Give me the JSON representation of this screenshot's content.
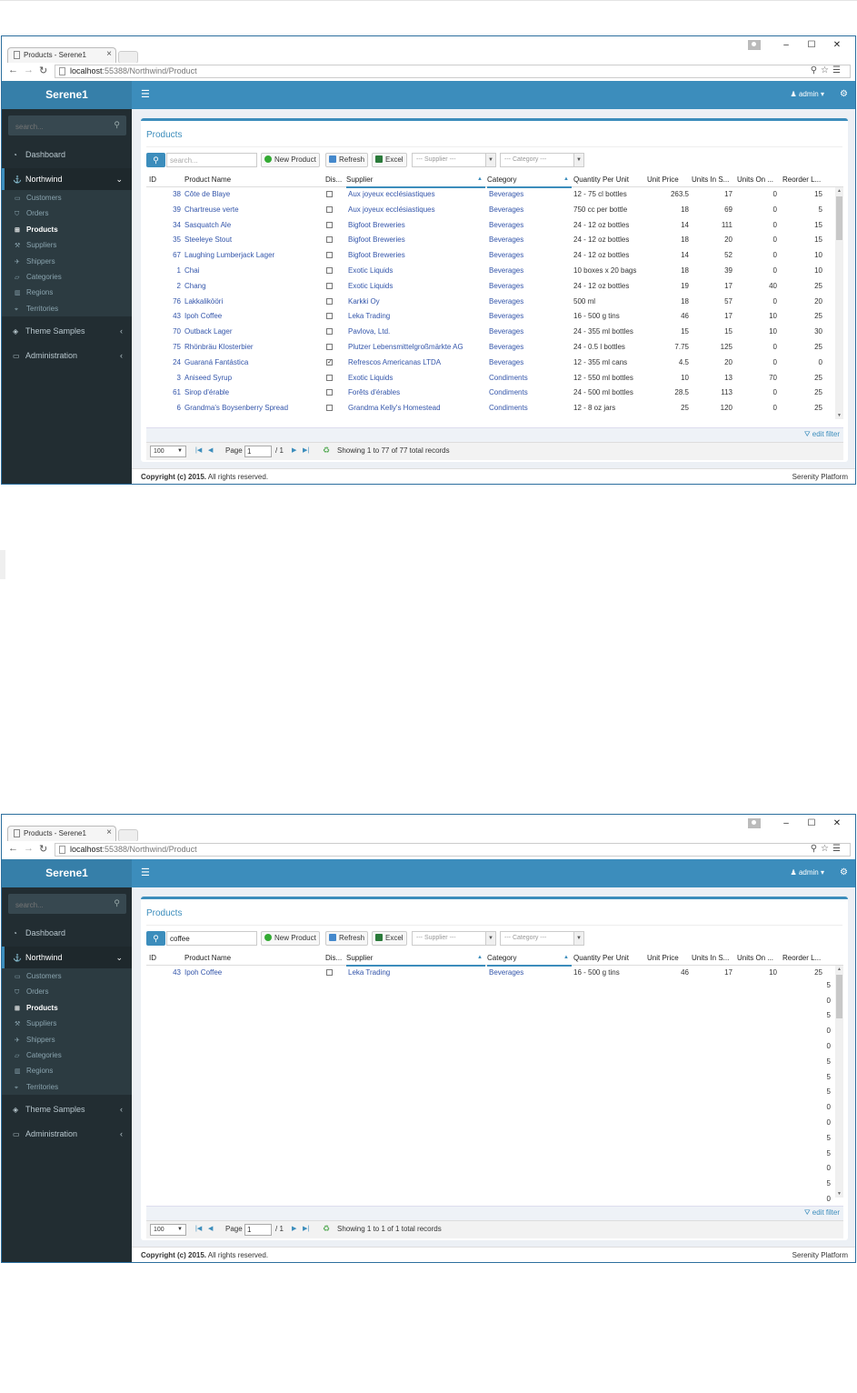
{
  "browser": {
    "tab_title": "Products - Serene1",
    "url_host": "localhost",
    "url_rest": ":55388/Northwind/Product"
  },
  "app": {
    "logo": "Serene1",
    "sidebar_search_placeholder": "search...",
    "user": "admin",
    "menu": {
      "dashboard": "Dashboard",
      "northwind": "Northwind",
      "theme_samples": "Theme Samples",
      "administration": "Administration",
      "sub": [
        "Customers",
        "Orders",
        "Products",
        "Suppliers",
        "Shippers",
        "Categories",
        "Regions",
        "Territories"
      ]
    },
    "page_title": "Products",
    "toolbar": {
      "search_placeholder": "search...",
      "new_product": "New Product",
      "refresh": "Refresh",
      "excel": "Excel",
      "supplier_dd": "--- Supplier ---",
      "category_dd": "--- Category ---"
    },
    "columns": [
      "ID",
      "Product Name",
      "Dis...",
      "Supplier",
      "Category",
      "Quantity Per Unit",
      "Unit Price",
      "Units In S...",
      "Units On ...",
      "Reorder L..."
    ],
    "edit_filter": "edit filter",
    "pager": {
      "page_size": "100",
      "page_label": "Page",
      "page_value": "1",
      "page_of": "/ 1"
    },
    "footer": {
      "copyright_bold": "Copyright (c) 2015.",
      "copyright_rest": "All rights reserved.",
      "platform": "Serenity Platform"
    }
  },
  "screens": [
    {
      "search_value": "",
      "status": "Showing 1 to 77 of 77 total records",
      "rows": [
        {
          "id": "38",
          "name": "Côte de Blaye",
          "disc": false,
          "supplier": "Aux joyeux ecclésiastiques",
          "category": "Beverages",
          "qty": "12 - 75 cl bottles",
          "price": "263.5",
          "stock": "17",
          "order": "0",
          "reorder": "15"
        },
        {
          "id": "39",
          "name": "Chartreuse verte",
          "disc": false,
          "supplier": "Aux joyeux ecclésiastiques",
          "category": "Beverages",
          "qty": "750 cc per bottle",
          "price": "18",
          "stock": "69",
          "order": "0",
          "reorder": "5"
        },
        {
          "id": "34",
          "name": "Sasquatch Ale",
          "disc": false,
          "supplier": "Bigfoot Breweries",
          "category": "Beverages",
          "qty": "24 - 12 oz bottles",
          "price": "14",
          "stock": "111",
          "order": "0",
          "reorder": "15"
        },
        {
          "id": "35",
          "name": "Steeleye Stout",
          "disc": false,
          "supplier": "Bigfoot Breweries",
          "category": "Beverages",
          "qty": "24 - 12 oz bottles",
          "price": "18",
          "stock": "20",
          "order": "0",
          "reorder": "15"
        },
        {
          "id": "67",
          "name": "Laughing Lumberjack Lager",
          "disc": false,
          "supplier": "Bigfoot Breweries",
          "category": "Beverages",
          "qty": "24 - 12 oz bottles",
          "price": "14",
          "stock": "52",
          "order": "0",
          "reorder": "10"
        },
        {
          "id": "1",
          "name": "Chai",
          "disc": false,
          "supplier": "Exotic Liquids",
          "category": "Beverages",
          "qty": "10 boxes x 20 bags",
          "price": "18",
          "stock": "39",
          "order": "0",
          "reorder": "10"
        },
        {
          "id": "2",
          "name": "Chang",
          "disc": false,
          "supplier": "Exotic Liquids",
          "category": "Beverages",
          "qty": "24 - 12 oz bottles",
          "price": "19",
          "stock": "17",
          "order": "40",
          "reorder": "25"
        },
        {
          "id": "76",
          "name": "Lakkalikööri",
          "disc": false,
          "supplier": "Karkki Oy",
          "category": "Beverages",
          "qty": "500 ml",
          "price": "18",
          "stock": "57",
          "order": "0",
          "reorder": "20"
        },
        {
          "id": "43",
          "name": "Ipoh Coffee",
          "disc": false,
          "supplier": "Leka Trading",
          "category": "Beverages",
          "qty": "16 - 500 g tins",
          "price": "46",
          "stock": "17",
          "order": "10",
          "reorder": "25"
        },
        {
          "id": "70",
          "name": "Outback Lager",
          "disc": false,
          "supplier": "Pavlova, Ltd.",
          "category": "Beverages",
          "qty": "24 - 355 ml bottles",
          "price": "15",
          "stock": "15",
          "order": "10",
          "reorder": "30"
        },
        {
          "id": "75",
          "name": "Rhönbräu Klosterbier",
          "disc": false,
          "supplier": "Plutzer Lebensmittelgroßmärkte AG",
          "category": "Beverages",
          "qty": "24 - 0.5 l bottles",
          "price": "7.75",
          "stock": "125",
          "order": "0",
          "reorder": "25"
        },
        {
          "id": "24",
          "name": "Guaraná Fantástica",
          "disc": true,
          "supplier": "Refrescos Americanas LTDA",
          "category": "Beverages",
          "qty": "12 - 355 ml cans",
          "price": "4.5",
          "stock": "20",
          "order": "0",
          "reorder": "0"
        },
        {
          "id": "3",
          "name": "Aniseed Syrup",
          "disc": false,
          "supplier": "Exotic Liquids",
          "category": "Condiments",
          "qty": "12 - 550 ml bottles",
          "price": "10",
          "stock": "13",
          "order": "70",
          "reorder": "25"
        },
        {
          "id": "61",
          "name": "Sirop d'érable",
          "disc": false,
          "supplier": "Forêts d'érables",
          "category": "Condiments",
          "qty": "24 - 500 ml bottles",
          "price": "28.5",
          "stock": "113",
          "order": "0",
          "reorder": "25"
        },
        {
          "id": "6",
          "name": "Grandma's Boysenberry Spread",
          "disc": false,
          "supplier": "Grandma Kelly's Homestead",
          "category": "Condiments",
          "qty": "12 - 8 oz jars",
          "price": "25",
          "stock": "120",
          "order": "0",
          "reorder": "25"
        }
      ]
    },
    {
      "search_value": "coffee",
      "status": "Showing 1 to 1 of 1 total records",
      "rows": [
        {
          "id": "43",
          "name": "Ipoh Coffee",
          "disc": false,
          "supplier": "Leka Trading",
          "category": "Beverages",
          "qty": "16 - 500 g tins",
          "price": "46",
          "stock": "17",
          "order": "10",
          "reorder": "25"
        }
      ],
      "ghost_digits": [
        "5",
        "0",
        "5",
        "0",
        "0",
        "5",
        "5",
        "5",
        "0",
        "0",
        "5",
        "5",
        "0",
        "5",
        "0"
      ]
    }
  ],
  "colors": {
    "header": "#3c8dbc",
    "logo_bg": "#367fa9",
    "sidebar": "#222d32",
    "link": "#3355aa"
  }
}
